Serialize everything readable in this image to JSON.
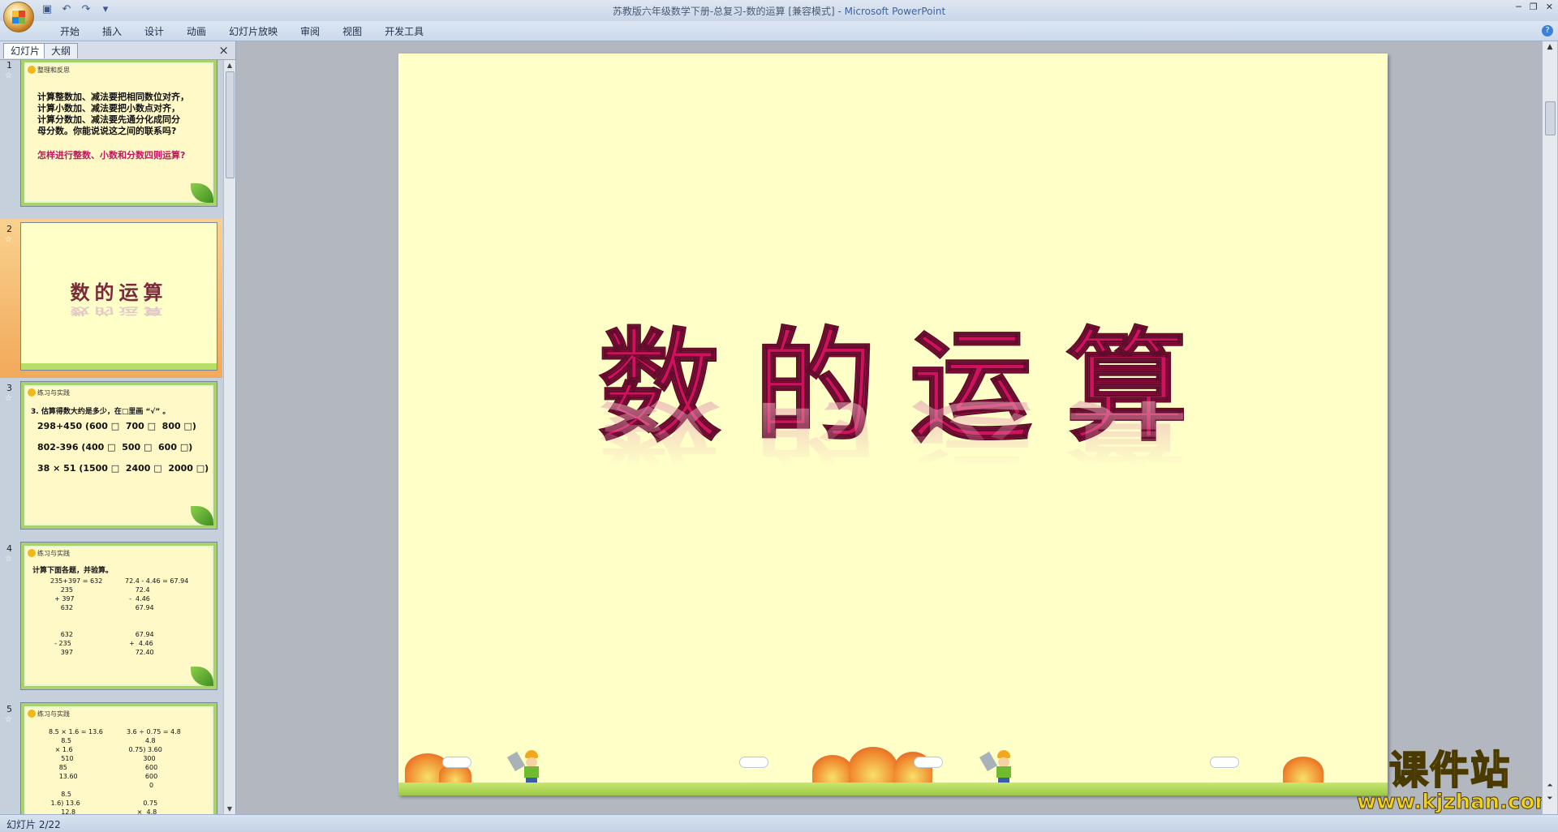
{
  "window": {
    "title": "苏教版六年级数学下册-总复习-数的运算 [兼容模式]",
    "app_sep": " - ",
    "app": "Microsoft PowerPoint"
  },
  "ribbon": {
    "tabs": [
      "开始",
      "插入",
      "设计",
      "动画",
      "幻灯片放映",
      "审阅",
      "视图",
      "开发工具"
    ]
  },
  "slides_pane": {
    "tab_slides": "幻灯片",
    "tab_outline": "大纲",
    "close_glyph": "×"
  },
  "thumbnails": [
    {
      "number": "1",
      "header": "整理和反思",
      "body": "计算整数加、减法要把相同数位对齐，\n计算小数加、减法要把小数点对齐，\n计算分数加、减法要先通分化成同分\n母分数。你能说说这之间的联系吗?",
      "question": "怎样进行整数、小数和分数四则运算?"
    },
    {
      "number": "2",
      "title": "数的运算"
    },
    {
      "number": "3",
      "header": "练习与实践",
      "body": "3. 估算得数大约是多少，在□里画 “√” 。",
      "lines": [
        "298+450 (600 □  700 □  800 □)",
        "802-396 (400 □  500 □  600 □)",
        "38 × 51 (1500 □  2400 □  2000 □)"
      ]
    },
    {
      "number": "4",
      "header": "练习与实践",
      "body": "计算下面各题，并验算。",
      "left": "235+397 = 632\n     235\n  + 397\n     632\n\n\n     632\n  - 235\n     397",
      "right": "72.4 - 4.46 = 67.94\n     72.4\n  -  4.46\n     67.94\n\n\n     67.94\n  +  4.46\n     72.40"
    },
    {
      "number": "5",
      "header": "练习与实践",
      "left": "8.5 × 1.6 = 13.6\n      8.5\n   × 1.6\n      510\n     85\n     13.60\n\n      8.5\n 1.6) 13.6\n      12.8",
      "right": "3.6 ÷ 0.75 = 4.8\n         4.8\n 0.75) 3.60\n        300\n         600\n         600\n           0\n\n        0.75\n     ×  4.8"
    }
  ],
  "slide": {
    "title": "数的运算"
  },
  "watermark": {
    "big": "课件站",
    "small": "www.kjzhan.com"
  },
  "status": {
    "slide_indicator": "幻灯片 2/22"
  },
  "colors": {
    "slide_bg": "#ffffc8",
    "title": "#d0125e",
    "selected_thumb": "#f2a95a"
  }
}
